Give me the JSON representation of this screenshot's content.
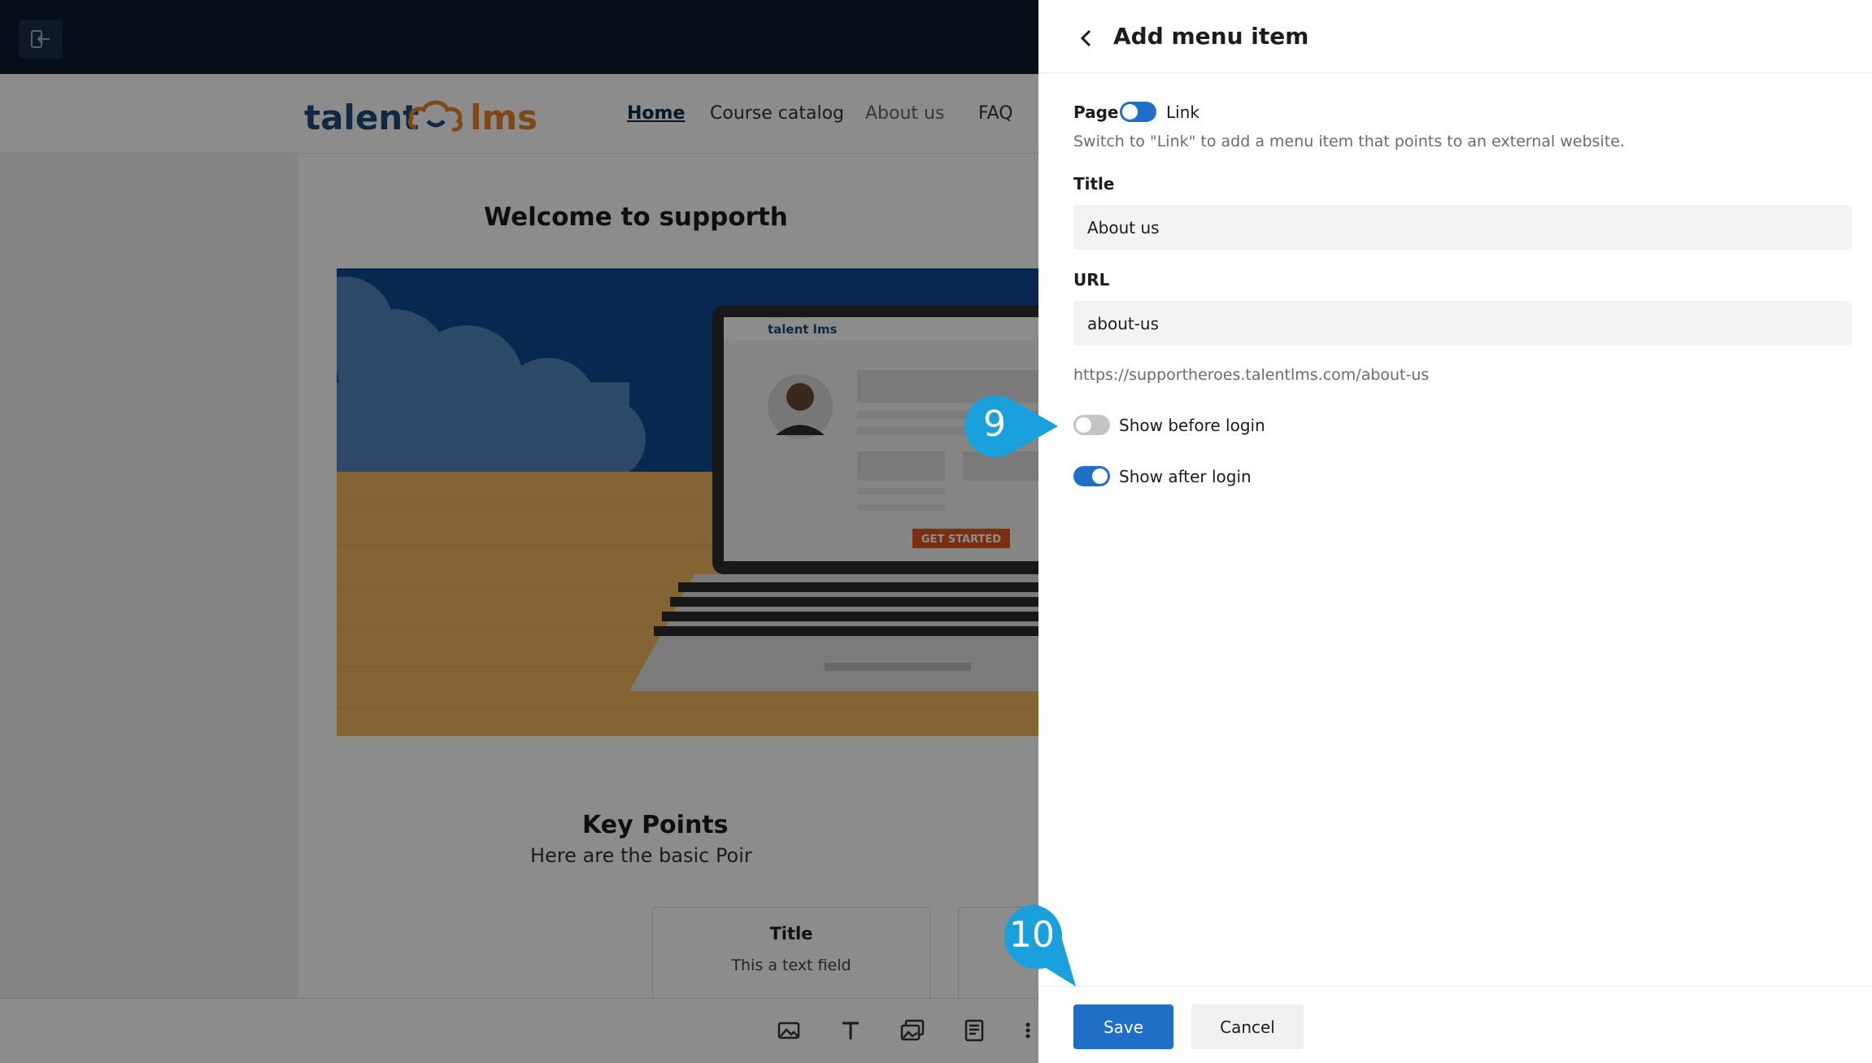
{
  "background": {
    "nav": {
      "home": "Home",
      "catalog": "Course catalog",
      "about": "About us",
      "faq": "FAQ"
    },
    "welcome": "Welcome to supporth",
    "hero_cta": "GET STARTED",
    "logo_mini": "talent lms",
    "key_points_title": "Key Points",
    "key_points_sub": "Here are the basic Poir",
    "card": {
      "title": "Title",
      "text": "This a text field"
    }
  },
  "panel": {
    "title": "Add menu item",
    "type_toggle": {
      "left": "Page",
      "right": "Link",
      "selected": "Page"
    },
    "type_hint": "Switch to \"Link\" to add a menu item that points to an external website.",
    "title_field": {
      "label": "Title",
      "value": "About us"
    },
    "url_field": {
      "label": "URL",
      "value": "about-us"
    },
    "full_url": "https://supportheroes.talentlms.com/about-us",
    "show_before_login": {
      "label": "Show before login",
      "on": false
    },
    "show_after_login": {
      "label": "Show after login",
      "on": true
    },
    "save": "Save",
    "cancel": "Cancel"
  },
  "callouts": {
    "step9": "9",
    "step10": "10"
  },
  "colors": {
    "accent": "#1f6fc7",
    "callout": "#1aa1dd",
    "topbar": "#0b1b31",
    "logo_blue": "#1e4b7a",
    "logo_orange": "#e8852a"
  },
  "icons": {
    "exit": "exit-icon",
    "back": "chevron-left-icon",
    "toolbar": [
      "image-icon",
      "text-icon",
      "gallery-icon",
      "book-icon",
      "list-icon"
    ]
  }
}
